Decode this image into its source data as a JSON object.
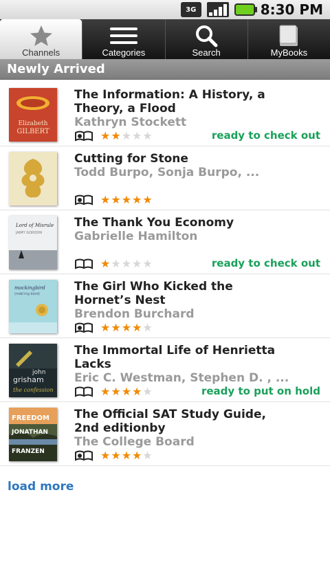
{
  "status_bar": {
    "network": "3G",
    "time": "8:30 PM",
    "battery_color": "#6fcf1f"
  },
  "tabs": [
    {
      "label": "Channels",
      "icon": "star-icon",
      "active": true
    },
    {
      "label": "Categories",
      "icon": "menu-icon",
      "active": false
    },
    {
      "label": "Search",
      "icon": "search-icon",
      "active": false
    },
    {
      "label": "MyBooks",
      "icon": "book-icon",
      "active": false
    }
  ],
  "section": {
    "title": "Newly Arrived"
  },
  "books": [
    {
      "title": "The Information: A History, a Theory, a Flood",
      "author": "Kathryn Stockett",
      "rating": 2,
      "status": "ready to check out",
      "cover": {
        "bg": "#c8442c",
        "text": "Elizabeth GILBERT"
      }
    },
    {
      "title": "Cutting for Stone",
      "author": "Todd Burpo, Sonja Burpo, ...",
      "rating": 5,
      "status": "",
      "cover": {
        "bg": "#efe6c4"
      }
    },
    {
      "title": "The Thank You Economy",
      "author": "Gabrielle Hamilton",
      "rating": 1,
      "status": "ready to check out",
      "cover": {
        "bg": "#e9e9ec",
        "text": "Lord of Misrule"
      }
    },
    {
      "title": "The Girl Who Kicked the Hornet’s Nest",
      "author": "Brendon Burchard",
      "rating": 4,
      "status": "",
      "cover": {
        "bg": "#a6d8e0",
        "text": "mockingbird"
      }
    },
    {
      "title": "The Immortal Life of Henrietta Lacks",
      "author": "Eric C. Westman, Stephen D. , ...",
      "rating": 4,
      "status": "ready to put on hold",
      "cover": {
        "bg": "#1e2a2e",
        "text": "john grisham the confession"
      }
    },
    {
      "title": "The Official SAT Study Guide, 2nd editionby",
      "author": "The College Board",
      "rating": 4,
      "status": "",
      "cover": {
        "bg": "#3a3f2c",
        "text": "FREEDOM JONATHAN FRANZEN"
      }
    }
  ],
  "load_more": "load more",
  "colors": {
    "accent": "#2e77c0",
    "status": "#1aa05a",
    "star": "#f18a05"
  }
}
